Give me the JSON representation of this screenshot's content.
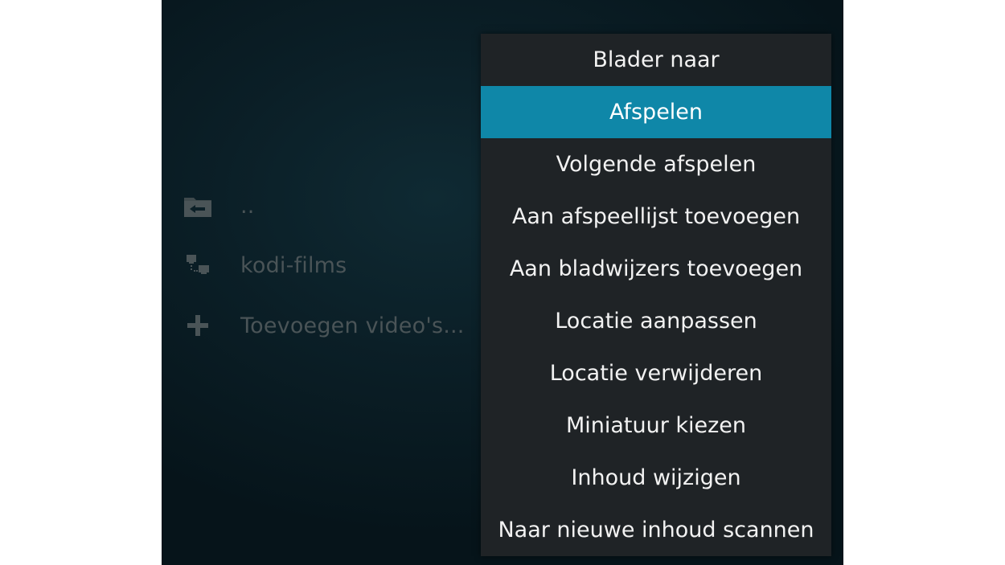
{
  "file_list": {
    "items": [
      {
        "label": "..",
        "icon": "folder-back-icon"
      },
      {
        "label": "kodi-films",
        "icon": "network-share-icon"
      },
      {
        "label": "Toevoegen video's...",
        "icon": "plus-icon"
      }
    ]
  },
  "context_menu": {
    "selected_index": 1,
    "items": [
      {
        "label": "Blader naar"
      },
      {
        "label": "Afspelen"
      },
      {
        "label": "Volgende afspelen"
      },
      {
        "label": "Aan afspeellijst toevoegen"
      },
      {
        "label": "Aan bladwijzers toevoegen"
      },
      {
        "label": "Locatie aanpassen"
      },
      {
        "label": "Locatie verwijderen"
      },
      {
        "label": "Miniatuur kiezen"
      },
      {
        "label": "Inhoud wijzigen"
      },
      {
        "label": "Naar nieuwe inhoud scannen"
      }
    ]
  },
  "colors": {
    "highlight": "#0f87a8",
    "menu_background": "#1f2326",
    "dimmed_text": "#4a5457"
  }
}
